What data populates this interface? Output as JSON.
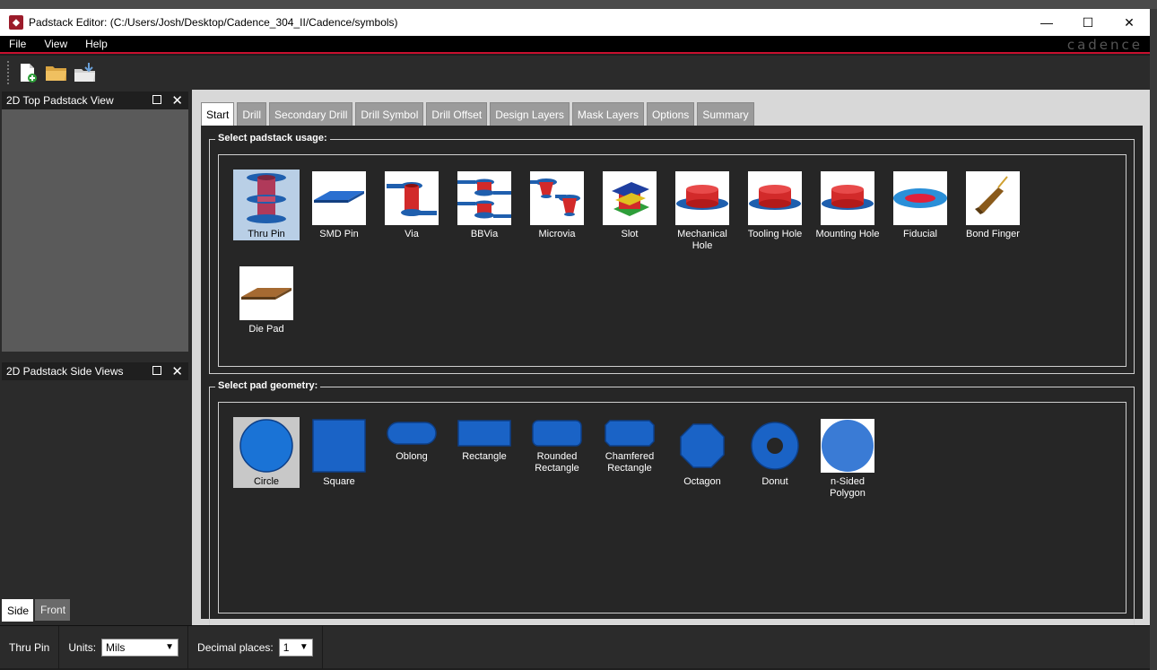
{
  "window": {
    "title": "Padstack Editor:  (C:/Users/Josh/Desktop/Cadence_304_II/Cadence/symbols)",
    "minimize_icon": "minimize-icon",
    "maximize_icon": "maximize-icon",
    "close_icon": "close-icon"
  },
  "menu": {
    "items": [
      "File",
      "View",
      "Help"
    ],
    "brand": "cadence"
  },
  "toolbar": {
    "buttons": [
      "new-padstack-icon",
      "open-folder-icon",
      "save-folder-icon"
    ]
  },
  "panels": {
    "top": {
      "title": "2D Top Padstack View"
    },
    "side": {
      "title": "2D Padstack Side Views"
    },
    "side_tabs": [
      "Side",
      "Front"
    ]
  },
  "tabs": [
    "Start",
    "Drill",
    "Secondary Drill",
    "Drill Symbol",
    "Drill Offset",
    "Design Layers",
    "Mask Layers",
    "Options",
    "Summary"
  ],
  "usage": {
    "label": "Select padstack usage:",
    "items": [
      {
        "label": "Thru Pin",
        "icon": "thru-pin-icon",
        "selected": true
      },
      {
        "label": "SMD Pin",
        "icon": "smd-pin-icon"
      },
      {
        "label": "Via",
        "icon": "via-icon"
      },
      {
        "label": "BBVia",
        "icon": "bbvia-icon"
      },
      {
        "label": "Microvia",
        "icon": "microvia-icon"
      },
      {
        "label": "Slot",
        "icon": "slot-icon"
      },
      {
        "label": "Mechanical Hole",
        "icon": "mechanical-hole-icon"
      },
      {
        "label": "Tooling Hole",
        "icon": "tooling-hole-icon"
      },
      {
        "label": "Mounting Hole",
        "icon": "mounting-hole-icon"
      },
      {
        "label": "Fiducial",
        "icon": "fiducial-icon"
      },
      {
        "label": "Bond Finger",
        "icon": "bond-finger-icon"
      },
      {
        "label": "Die Pad",
        "icon": "die-pad-icon"
      }
    ]
  },
  "geometry": {
    "label": "Select pad geometry:",
    "items": [
      {
        "label": "Circle",
        "icon": "circle-icon",
        "selected": true
      },
      {
        "label": "Square",
        "icon": "square-icon"
      },
      {
        "label": "Oblong",
        "icon": "oblong-icon"
      },
      {
        "label": "Rectangle",
        "icon": "rectangle-icon"
      },
      {
        "label": "Rounded Rectangle",
        "icon": "rounded-rectangle-icon"
      },
      {
        "label": "Chamfered Rectangle",
        "icon": "chamfered-rectangle-icon"
      },
      {
        "label": "Octagon",
        "icon": "octagon-icon"
      },
      {
        "label": "Donut",
        "icon": "donut-icon"
      },
      {
        "label": "n-Sided Polygon",
        "icon": "n-sided-polygon-icon"
      }
    ]
  },
  "status": {
    "usage": "Thru Pin",
    "units_label": "Units:",
    "units_value": "Mils",
    "decimal_label": "Decimal places:",
    "decimal_value": "1"
  },
  "colors": {
    "accent_red": "#c8102e",
    "pad_blue": "#1565c0",
    "barrel_red": "#d32f2f"
  }
}
